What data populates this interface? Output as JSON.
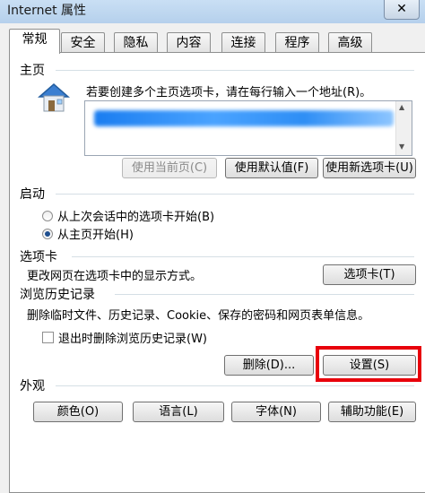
{
  "window": {
    "title": "Internet 属性",
    "close_glyph": "✕"
  },
  "tabs": [
    {
      "label": "常规",
      "active": true
    },
    {
      "label": "安全"
    },
    {
      "label": "隐私"
    },
    {
      "label": "内容"
    },
    {
      "label": "连接"
    },
    {
      "label": "程序"
    },
    {
      "label": "高级"
    }
  ],
  "home": {
    "section_label": "主页",
    "description": "若要创建多个主页选项卡，请在每行输入一个地址(R)。",
    "icon": "house-icon",
    "buttons": [
      "使用当前页(C)",
      "使用默认值(F)",
      "使用新选项卡(U)"
    ]
  },
  "startup": {
    "section_label": "启动",
    "options": [
      "从上次会话中的选项卡开始(B)",
      "从主页开始(H)"
    ],
    "selected": 1
  },
  "tabs_section": {
    "section_label": "选项卡",
    "description": "更改网页在选项卡中的显示方式。",
    "button": "选项卡(T)"
  },
  "history": {
    "section_label": "浏览历史记录",
    "description": "删除临时文件、历史记录、Cookie、保存的密码和网页表单信息。",
    "checkbox_label": "退出时删除浏览历史记录(W)",
    "checked": false,
    "delete_button": "删除(D)...",
    "settings_button": "设置(S)"
  },
  "appearance": {
    "section_label": "外观",
    "buttons": [
      "颜色(O)",
      "语言(L)",
      "字体(N)",
      "辅助功能(E)"
    ]
  },
  "colors": {
    "highlight": "#e8000b",
    "selected_radio": "#1f4f8f"
  }
}
